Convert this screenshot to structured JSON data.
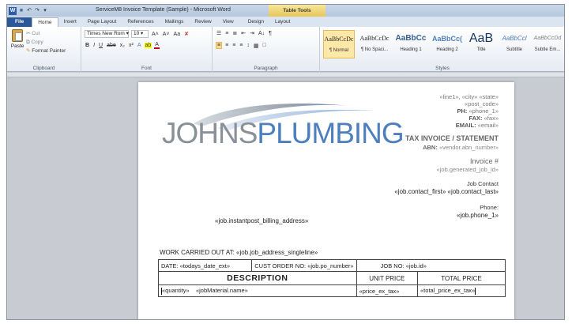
{
  "window": {
    "title": "ServiceM8 Invoice Template (Sample) - Microsoft Word",
    "context_tab": "Table Tools"
  },
  "qat": {
    "app_icon": "W",
    "save": "■",
    "undo": "↶",
    "redo": "↷",
    "customize": "▾"
  },
  "tabs": [
    "File",
    "Home",
    "Insert",
    "Page Layout",
    "References",
    "Mailings",
    "Review",
    "View",
    "Design",
    "Layout"
  ],
  "active_tab": "Home",
  "ribbon": {
    "clipboard": {
      "paste": "Paste",
      "cut": "Cut",
      "copy": "Copy",
      "format_painter": "Format Painter",
      "label": "Clipboard"
    },
    "font": {
      "font_name": "Times New Rom",
      "font_size": "10",
      "grow": "A˄",
      "shrink": "A˅",
      "change_case": "Aa",
      "clear": "✘",
      "bold": "B",
      "italic": "I",
      "underline": "U",
      "strike": "abe",
      "subscript": "x₂",
      "superscript": "x²",
      "effects": "A",
      "highlight": "ab",
      "color": "A",
      "label": "Font"
    },
    "paragraph": {
      "bullets": "☰",
      "numbering": "≡",
      "multilevel": "≣",
      "decrease_indent": "⇤",
      "increase_indent": "⇥",
      "sort": "A↓",
      "show_marks": "¶",
      "align_left": "≡",
      "center": "≡",
      "align_right": "≡",
      "justify": "≡",
      "line_spacing": "↕",
      "shading": "▦",
      "borders": "□",
      "label": "Paragraph"
    },
    "styles": {
      "label": "Styles",
      "items": [
        {
          "sample": "AaBbCcDc",
          "name": "¶ Normal"
        },
        {
          "sample": "AaBbCcDc",
          "name": "¶ No Spaci..."
        },
        {
          "sample": "AaBbCc",
          "name": "Heading 1"
        },
        {
          "sample": "AaBbCc(",
          "name": "Heading 2"
        },
        {
          "sample": "AaB",
          "name": "Title"
        },
        {
          "sample": "AaBbCcl",
          "name": "Subtitle"
        },
        {
          "sample": "AaBbCcDd",
          "name": "Subtle Em..."
        }
      ]
    }
  },
  "document": {
    "logo": {
      "part1": "JOHNS",
      "part2": "PLUMBING"
    },
    "address_line": "«line1», «city» «state»",
    "post_code": "«post_code»",
    "phone": {
      "label": "PH:",
      "value": "«phone_1»"
    },
    "fax": {
      "label": "FAX:",
      "value": "«fax»"
    },
    "email": {
      "label": "EMAIL:",
      "value": "«email»"
    },
    "tax_title": "TAX INVOICE / STATEMENT",
    "abn": {
      "label": "ABN:",
      "value": "«vendor.abn_number»"
    },
    "invoice_label": "Invoice #",
    "invoice_id": "«job.generated_job_id»",
    "job_contact_label": "Job Contact",
    "job_contact_value": "«job.contact_first» «job.contact_last»",
    "phone_label": "Phone:",
    "phone_value": "«job.phone_1»",
    "billing_address": "«job.instantpost_billing_address»",
    "work_carried_out": "WORK CARRIED OUT AT: «job.job_address_singleline»",
    "table": {
      "date": "DATE: «todays_date_ext»",
      "cust_order": "CUST ORDER NO: «job.po_number»",
      "job_no": "JOB NO: «job.id»",
      "headers": [
        "DESCRIPTION",
        "UNIT PRICE",
        "TOTAL PRICE"
      ],
      "row": {
        "quantity": "«quantity»",
        "material": "«jobMaterial.name»",
        "unit_price": "«price_ex_tax»",
        "total_price": "«total_price_ex_tax»"
      }
    }
  }
}
